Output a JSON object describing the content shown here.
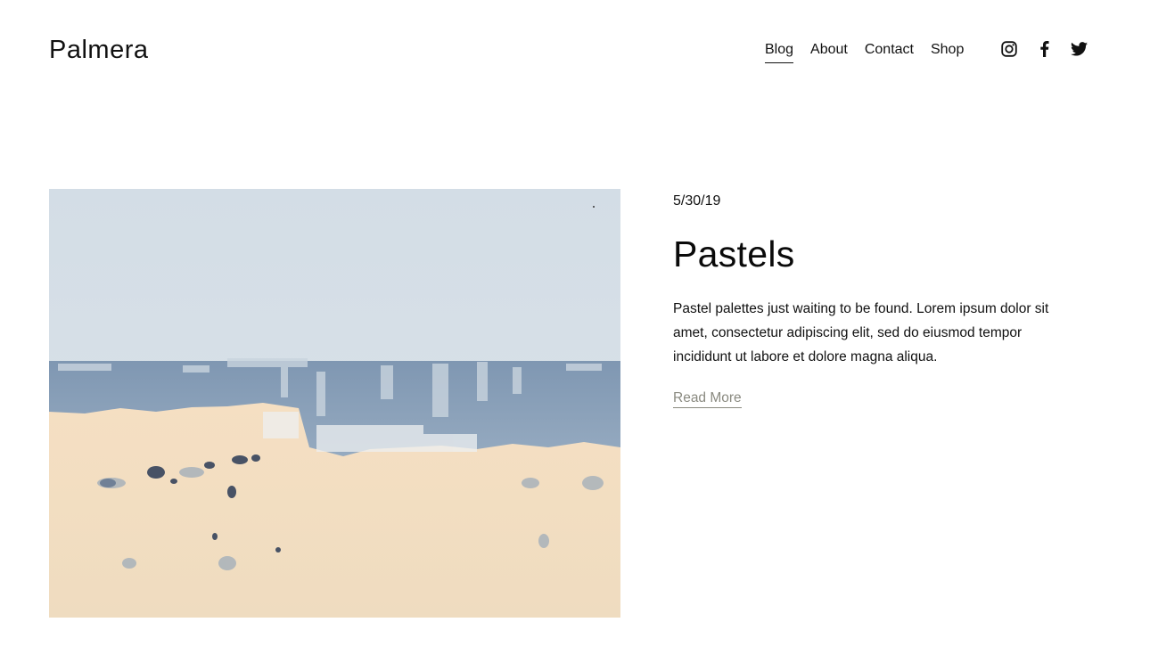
{
  "header": {
    "logo": "Palmera",
    "nav": [
      {
        "label": "Blog",
        "active": true
      },
      {
        "label": "About",
        "active": false
      },
      {
        "label": "Contact",
        "active": false
      },
      {
        "label": "Shop",
        "active": false
      }
    ],
    "social_icons": [
      "instagram-icon",
      "facebook-icon",
      "twitter-icon"
    ]
  },
  "post": {
    "date": "5/30/19",
    "title": "Pastels",
    "excerpt": "Pastel palettes just waiting to be found. Lorem ipsum dolor sit amet, consectetur adipiscing elit, sed do eiusmod tempor incididunt ut labore et dolore magna aliqua.",
    "read_more": "Read More"
  },
  "colors": {
    "sky": "#d9e1e8",
    "blue_band": "#8ea3bb",
    "sand": "#f2dfc3",
    "link_muted": "#8a8a80"
  }
}
